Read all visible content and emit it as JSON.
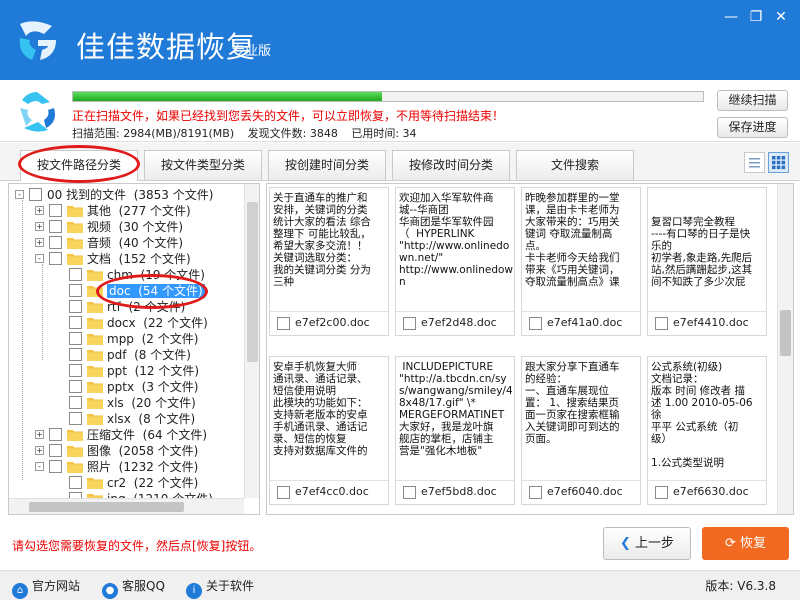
{
  "app": {
    "title": "佳佳数据恢复",
    "edition": "专业版",
    "window_controls": [
      "minimize-icon",
      "maximize-icon",
      "close-icon"
    ]
  },
  "scan": {
    "progress": 0.49,
    "message": "正在扫描文件，如果已经找到您丢失的文件，可以立即恢复，不用等待扫描结束！",
    "range": "扫描范围: 2984(MB)/8191(MB)",
    "found": "发现文件数: 3848",
    "elapsed": "已用时间: 34",
    "continue_label": "继续扫描",
    "save_label": "保存进度"
  },
  "tabs": [
    {
      "label": "按文件路径分类",
      "active": true
    },
    {
      "label": "按文件类型分类",
      "active": false
    },
    {
      "label": "按创建时间分类",
      "active": false
    },
    {
      "label": "按修改时间分类",
      "active": false
    },
    {
      "label": "文件搜索",
      "active": false
    }
  ],
  "view_icons": [
    "list-view-icon",
    "grid-view-icon"
  ],
  "tree": [
    {
      "label": "00 找到的文件",
      "count": "(3853 个文件)",
      "level": 0,
      "expander": "-",
      "folder": false
    },
    {
      "label": "其他",
      "count": "(277 个文件)",
      "level": 1,
      "expander": "+",
      "folder": true
    },
    {
      "label": "视频",
      "count": "(30 个文件)",
      "level": 1,
      "expander": "+",
      "folder": true
    },
    {
      "label": "音频",
      "count": "(40 个文件)",
      "level": 1,
      "expander": "+",
      "folder": true
    },
    {
      "label": "文档",
      "count": "(152 个文件)",
      "level": 1,
      "expander": "-",
      "folder": true
    },
    {
      "label": "chm",
      "count": "(19 个文件)",
      "level": 2,
      "expander": "",
      "folder": true
    },
    {
      "label": "doc",
      "count": "(54 个文件)",
      "level": 2,
      "expander": "",
      "folder": true,
      "selected": true
    },
    {
      "label": "rtf",
      "count": "(2 个文件)",
      "level": 2,
      "expander": "",
      "folder": true
    },
    {
      "label": "docx",
      "count": "(22 个文件)",
      "level": 2,
      "expander": "",
      "folder": true
    },
    {
      "label": "mpp",
      "count": "(2 个文件)",
      "level": 2,
      "expander": "",
      "folder": true
    },
    {
      "label": "pdf",
      "count": "(8 个文件)",
      "level": 2,
      "expander": "",
      "folder": true
    },
    {
      "label": "ppt",
      "count": "(12 个文件)",
      "level": 2,
      "expander": "",
      "folder": true
    },
    {
      "label": "pptx",
      "count": "(3 个文件)",
      "level": 2,
      "expander": "",
      "folder": true
    },
    {
      "label": "xls",
      "count": "(20 个文件)",
      "level": 2,
      "expander": "",
      "folder": true
    },
    {
      "label": "xlsx",
      "count": "(8 个文件)",
      "level": 2,
      "expander": "",
      "folder": true
    },
    {
      "label": "压缩文件",
      "count": "(64 个文件)",
      "level": 1,
      "expander": "+",
      "folder": true
    },
    {
      "label": "图像",
      "count": "(2058 个文件)",
      "level": 1,
      "expander": "+",
      "folder": true
    },
    {
      "label": "照片",
      "count": "(1232 个文件)",
      "level": 1,
      "expander": "-",
      "folder": true
    },
    {
      "label": "cr2",
      "count": "(22 个文件)",
      "level": 2,
      "expander": "",
      "folder": true
    },
    {
      "label": "jpg",
      "count": "(1210 个文件)",
      "level": 2,
      "expander": "",
      "folder": true
    }
  ],
  "cards": [
    {
      "text": "关于直通车的推广和\n安排，关键词的分类\n统计大家的看法 综合\n整理下 可能比较乱，\n希望大家多交流！！\n关键词选取分类：\n我的关键词分类 分为\n三种",
      "file": "e7ef2c00.doc"
    },
    {
      "text": "欢迎加入华军软件商\n城--华商团\n华商团是华军软件园\n（  HYPERLINK\n\"http://www.onlinedown.net/\"\nhttp://www.onlinedown",
      "file": "e7ef2d48.doc"
    },
    {
      "text": "昨晚参加群里的一堂\n课，是由卡卡老师为\n大家带来的：巧用关\n键词 夺取流量制高\n点。\n卡卡老师今天给我们\n带来《巧用关键词，\n夺取流量制高点》课",
      "file": "e7ef41a0.doc"
    },
    {
      "text": "\n\n复習口琴完全教程\n----有口琴的日子是快\n乐的\n初学者,象走路,先爬后\n站,然后蹒跚起步,这其\n间不知跌了多少次屁",
      "file": "e7ef4410.doc"
    },
    {
      "text": "安卓手机恢复大师\n通讯录、通话记录、\n短信使用说明\n此模块的功能如下：\n支持新老版本的安卓\n手机通讯录、通话记\n录、短信的恢复\n支持对数据库文件的",
      "file": "e7ef4cc0.doc"
    },
    {
      "text": " INCLUDEPICTURE\n\"http://a.tbcdn.cn/sys/wangwang/smiley/48x48/17.gif\" \\*\nMERGEFORMATINET\n大家好，我是龙叶旗\n舰店的掌柜，店铺主\n营是\"强化木地板\"",
      "file": "e7ef5bd8.doc"
    },
    {
      "text": "跟大家分享下直通车\n的经验：\n一、直通车展现位\n置： 1、搜索结果页\n面一页家在搜索框输\n入关键词即可到达的\n页面。",
      "file": "e7ef6040.doc"
    },
    {
      "text": "公式系统(初级)\n文档记录：\n版本 时间 修改者 描\n述 1.00 2010-05-06 徐\n平平 公式系统（初\n级）\n\n1.公式类型说明",
      "file": "e7ef6630.doc"
    }
  ],
  "bottom": {
    "hint": "请勾选您需要恢复的文件，然后点[恢复]按钮。",
    "prev_label": "上一步",
    "recover_label": "恢复"
  },
  "footer": {
    "links": [
      {
        "label": "官方网站",
        "icon": "home-icon"
      },
      {
        "label": "客服QQ",
        "icon": "qq-icon"
      },
      {
        "label": "关于软件",
        "icon": "info-icon"
      }
    ],
    "version": "版本: V6.3.8"
  },
  "colors": {
    "titlebar": "#1f7ad8",
    "progress": "#1ea91e",
    "warning_text": "#ee0000",
    "recover_button": "#f26a21",
    "highlight_circle": "#e01919"
  }
}
